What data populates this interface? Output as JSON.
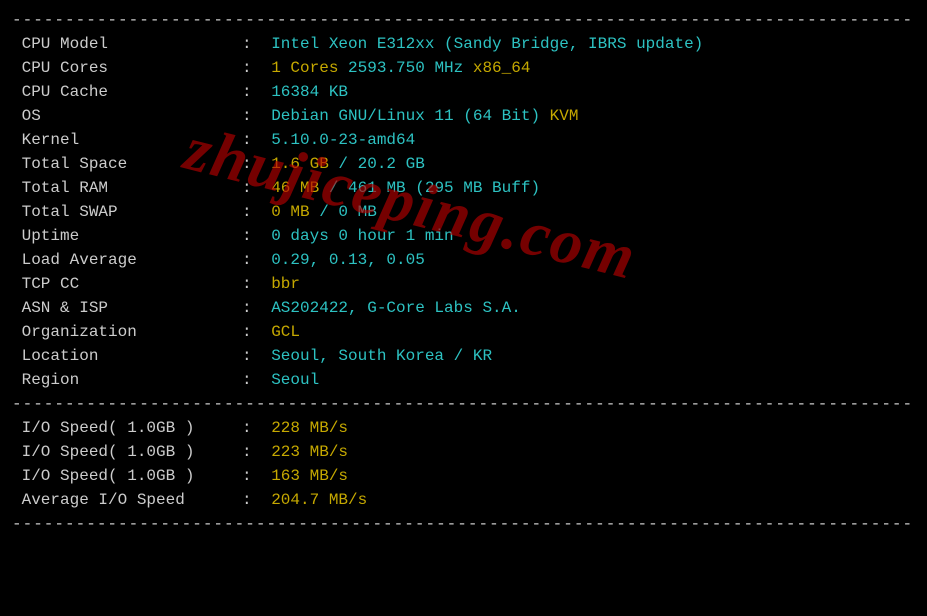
{
  "watermark": "zhujiceping.com",
  "separator": "----------------------------------------------------------------------------------------",
  "sysinfo": [
    {
      "label": "CPU Model",
      "parts": [
        {
          "text": "Intel Xeon E312xx (Sandy Bridge, IBRS update)",
          "cls": "cyan"
        }
      ]
    },
    {
      "label": "CPU Cores",
      "parts": [
        {
          "text": "1 Cores",
          "cls": "yellow"
        },
        {
          "text": " 2593.750 MHz ",
          "cls": "cyan"
        },
        {
          "text": "x86_64",
          "cls": "yellow"
        }
      ]
    },
    {
      "label": "CPU Cache",
      "parts": [
        {
          "text": "16384 KB",
          "cls": "cyan"
        }
      ]
    },
    {
      "label": "OS",
      "parts": [
        {
          "text": "Debian GNU/Linux 11 (64 Bit)",
          "cls": "cyan"
        },
        {
          "text": " KVM",
          "cls": "yellow"
        }
      ]
    },
    {
      "label": "Kernel",
      "parts": [
        {
          "text": "5.10.0-23-amd64",
          "cls": "cyan"
        }
      ]
    },
    {
      "label": "Total Space",
      "parts": [
        {
          "text": "1.6 GB",
          "cls": "yellow"
        },
        {
          "text": " / ",
          "cls": "cyan"
        },
        {
          "text": "20.2 GB",
          "cls": "cyan"
        }
      ]
    },
    {
      "label": "Total RAM",
      "parts": [
        {
          "text": "46 MB",
          "cls": "yellow"
        },
        {
          "text": " / ",
          "cls": "cyan"
        },
        {
          "text": "461 MB",
          "cls": "cyan"
        },
        {
          "text": " (295 MB Buff)",
          "cls": "cyan"
        }
      ]
    },
    {
      "label": "Total SWAP",
      "parts": [
        {
          "text": "0 MB",
          "cls": "yellow"
        },
        {
          "text": " / ",
          "cls": "cyan"
        },
        {
          "text": "0 MB",
          "cls": "cyan"
        }
      ]
    },
    {
      "label": "Uptime",
      "parts": [
        {
          "text": "0 days 0 hour 1 min",
          "cls": "cyan"
        }
      ]
    },
    {
      "label": "Load Average",
      "parts": [
        {
          "text": "0.29, 0.13, 0.05",
          "cls": "cyan"
        }
      ]
    },
    {
      "label": "TCP CC",
      "parts": [
        {
          "text": "bbr",
          "cls": "yellow"
        }
      ]
    },
    {
      "label": "ASN & ISP",
      "parts": [
        {
          "text": "AS202422, G-Core Labs S.A.",
          "cls": "cyan"
        }
      ]
    },
    {
      "label": "Organization",
      "parts": [
        {
          "text": "GCL",
          "cls": "yellow"
        }
      ]
    },
    {
      "label": "Location",
      "parts": [
        {
          "text": "Seoul, South Korea / KR",
          "cls": "cyan"
        }
      ]
    },
    {
      "label": "Region",
      "parts": [
        {
          "text": "Seoul",
          "cls": "cyan"
        }
      ]
    }
  ],
  "io": [
    {
      "label": "I/O Speed( 1.0GB )",
      "parts": [
        {
          "text": "228 MB/s",
          "cls": "yellow"
        }
      ]
    },
    {
      "label": "I/O Speed( 1.0GB )",
      "parts": [
        {
          "text": "223 MB/s",
          "cls": "yellow"
        }
      ]
    },
    {
      "label": "I/O Speed( 1.0GB )",
      "parts": [
        {
          "text": "163 MB/s",
          "cls": "yellow"
        }
      ]
    },
    {
      "label": "Average I/O Speed",
      "parts": [
        {
          "text": "204.7 MB/s",
          "cls": "yellow"
        }
      ]
    }
  ]
}
